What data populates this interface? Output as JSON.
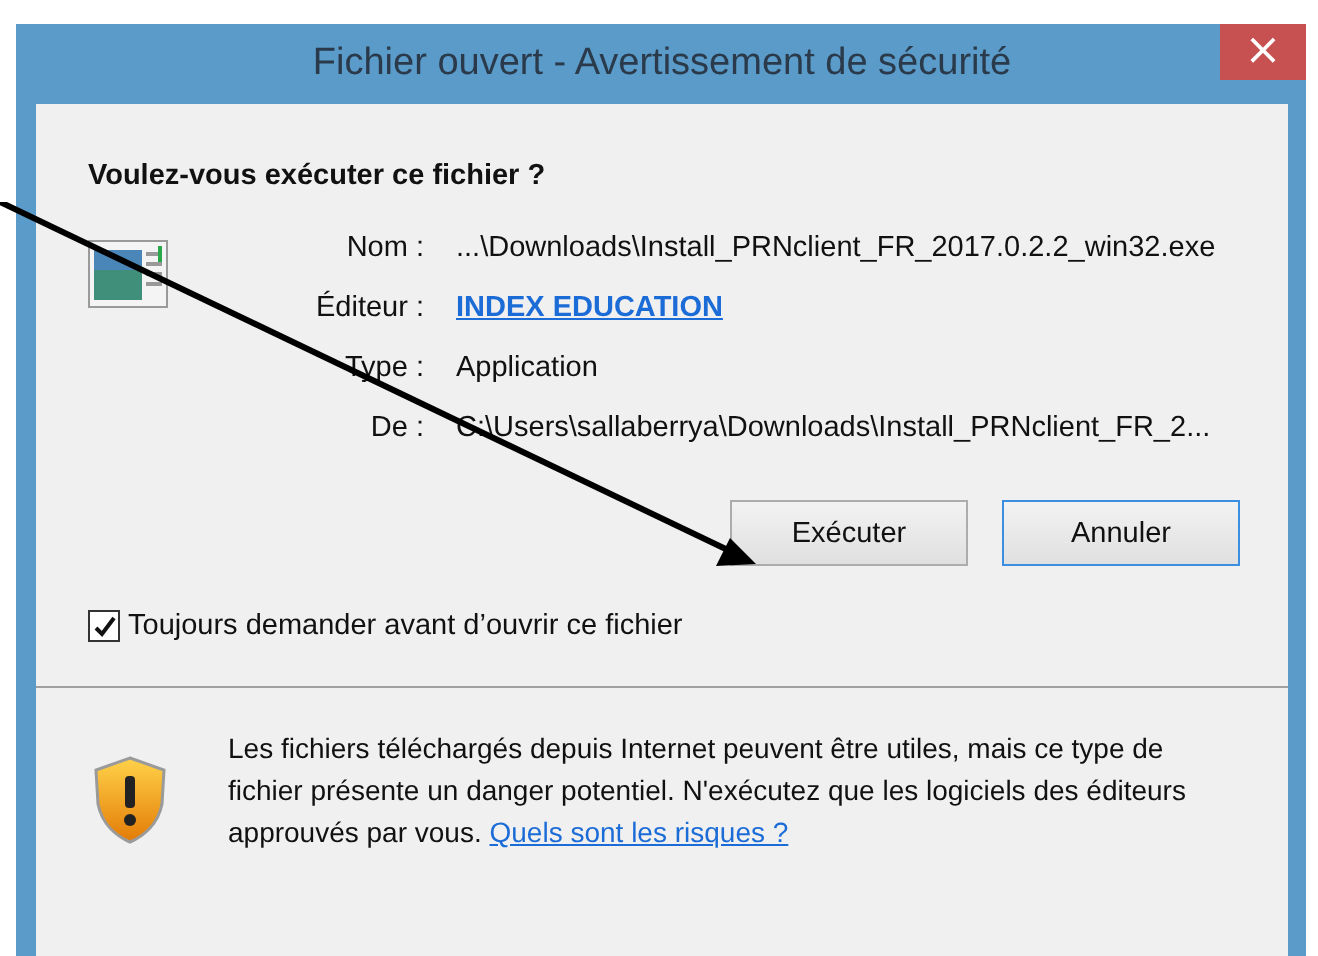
{
  "window": {
    "title": "Fichier ouvert - Avertissement de sécurité",
    "close": "×"
  },
  "question": "Voulez-vous exécuter ce fichier ?",
  "fields": [
    {
      "label": "Nom :",
      "value": "...\\Downloads\\Install_PRNclient_FR_2017.0.2.2_win32.exe",
      "kind": "text"
    },
    {
      "label": "Éditeur :",
      "value": "INDEX EDUCATION",
      "kind": "link"
    },
    {
      "label": "Type :",
      "value": "Application",
      "kind": "text"
    },
    {
      "label": "De :",
      "value": "C:\\Users\\sallaberrya\\Downloads\\Install_PRNclient_FR_2...",
      "kind": "text"
    }
  ],
  "buttons": [
    {
      "label": "Exécuter",
      "selected": false
    },
    {
      "label": "Annuler",
      "selected": true
    }
  ],
  "checkbox": {
    "label": "Toujours demander avant d’ouvrir ce fichier",
    "checked": true
  },
  "warning": {
    "text": "Les fichiers téléchargés depuis Internet peuvent être utiles, mais ce type de fichier présente un danger potentiel. N'exécutez que les logiciels des éditeurs approuvés par vous.",
    "link": "Quels sont les risques ?"
  }
}
